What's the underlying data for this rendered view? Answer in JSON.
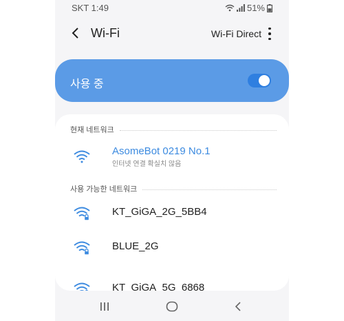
{
  "status_bar": {
    "carrier_time": "SKT 1:49",
    "battery": "51%",
    "icons": [
      "wifi-icon",
      "signal-icon",
      "battery-icon"
    ]
  },
  "app_bar": {
    "title": "Wi-Fi",
    "wifi_direct_label": "Wi-Fi Direct",
    "icons": [
      "back-arrow-icon",
      "more-vert-icon"
    ]
  },
  "master_toggle": {
    "label": "사용 중",
    "state": "on"
  },
  "current_network": {
    "section_label": "현재 네트워크",
    "name": "AsomeBot 0219 No.1",
    "status": "인터넷 연결 확실치 않음",
    "icon": "wifi-icon"
  },
  "available_networks": {
    "section_label": "사용 가능한 네트워크",
    "items": [
      {
        "name": "KT_GiGA_2G_5BB4",
        "icon": "wifi-locked-icon"
      },
      {
        "name": "BLUE_2G",
        "icon": "wifi-locked-icon"
      },
      {
        "name": "KT_GiGA_5G_6868",
        "icon": "wifi-locked-icon"
      }
    ]
  },
  "nav_bar": {
    "icons": [
      "recent-apps-icon",
      "home-icon",
      "back-icon"
    ]
  },
  "colors": {
    "accent": "#3d8be0",
    "toggle_bar": "#5b9be6",
    "background": "#f5f5f7"
  }
}
